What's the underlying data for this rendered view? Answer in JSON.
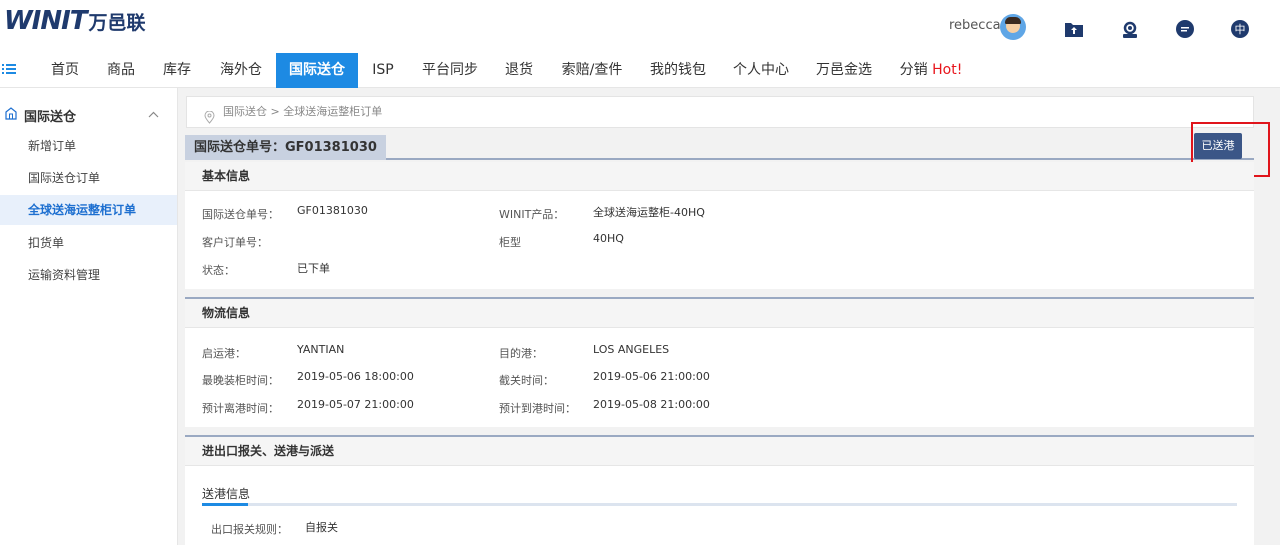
{
  "brand": {
    "mark": "WINIT",
    "name": "万邑联"
  },
  "user": {
    "name": "rebecca"
  },
  "top_icons": [
    "upload-folder-icon",
    "support-agent-icon",
    "message-icon",
    "language-icon"
  ],
  "language_glyph": "中",
  "nav": {
    "items": [
      {
        "label": "首页"
      },
      {
        "label": "商品"
      },
      {
        "label": "库存"
      },
      {
        "label": "海外仓"
      },
      {
        "label": "国际送仓"
      },
      {
        "label": "ISP"
      },
      {
        "label": "平台同步"
      },
      {
        "label": "退货"
      },
      {
        "label": "索赔/查件"
      },
      {
        "label": "我的钱包"
      },
      {
        "label": "个人中心"
      },
      {
        "label": "万邑金选"
      },
      {
        "label": "分销"
      }
    ],
    "hot_label": "Hot!"
  },
  "sidebar": {
    "title": "国际送仓",
    "items": [
      {
        "label": "新增订单"
      },
      {
        "label": "国际送仓订单"
      },
      {
        "label": "全球送海运整柜订单"
      },
      {
        "label": "扣货单"
      },
      {
        "label": "运输资料管理"
      }
    ]
  },
  "breadcrumb": {
    "text": "国际送仓 > 全球送海运整柜订单"
  },
  "order": {
    "label": "国际送仓单号：GF01381030",
    "status_button": "已送港"
  },
  "basic_info": {
    "title": "基本信息",
    "fields": [
      {
        "label": "国际送仓单号：",
        "value": "GF01381030"
      },
      {
        "label": "WINIT产品：",
        "value": "全球送海运整柜-40HQ"
      },
      {
        "label": "客户订单号：",
        "value": ""
      },
      {
        "label": "柜型",
        "value": "40HQ"
      },
      {
        "label": "状态：",
        "value": "已下单"
      }
    ]
  },
  "logistics_info": {
    "title": "物流信息",
    "fields": [
      {
        "label": "启运港：",
        "value": "YANTIAN"
      },
      {
        "label": "目的港：",
        "value": "LOS ANGELES"
      },
      {
        "label": "最晚装柜时间：",
        "value": "2019-05-06 18:00:00"
      },
      {
        "label": "截关时间：",
        "value": "2019-05-06 21:00:00"
      },
      {
        "label": "预计离港时间：",
        "value": "2019-05-07 21:00:00"
      },
      {
        "label": "预计到港时间：",
        "value": "2019-05-08 21:00:00"
      }
    ]
  },
  "customs_section": {
    "title": "进出口报关、送港与派送",
    "subtab": "送港信息",
    "fields": [
      {
        "label": "出口报关规则：",
        "value": "自报关"
      }
    ]
  }
}
